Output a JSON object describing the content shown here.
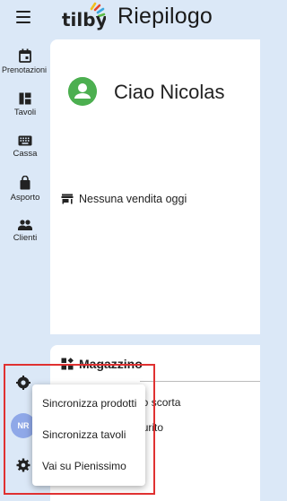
{
  "header": {
    "title": "Riepilogo",
    "logo_text": "tilby",
    "menu_icon": "hamburger-menu-icon"
  },
  "sidebar": {
    "items": [
      {
        "label": "Prenotazioni",
        "icon": "calendar-icon"
      },
      {
        "label": "Tavoli",
        "icon": "tables-icon"
      },
      {
        "label": "Cassa",
        "icon": "keyboard-icon"
      },
      {
        "label": "Asporto",
        "icon": "bag-icon"
      },
      {
        "label": "Clienti",
        "icon": "people-icon"
      }
    ],
    "user_initials": "NR"
  },
  "greeting": {
    "text": "Ciao Nicolas"
  },
  "sales": {
    "empty_text": "Nessuna vendita oggi"
  },
  "warehouse": {
    "title": "Magazzino",
    "items": [
      "cto sotto scorta",
      "cto esaurito"
    ]
  },
  "popup_menu": {
    "items": [
      "Sincronizza prodotti",
      "Sincronizza tavoli",
      "Vai su Pienissimo"
    ]
  },
  "colors": {
    "background": "#dbe8f7",
    "card": "#ffffff",
    "greeting_avatar": "#4caf50",
    "user_avatar": "#8fa8e8",
    "highlight": "#e03131"
  }
}
